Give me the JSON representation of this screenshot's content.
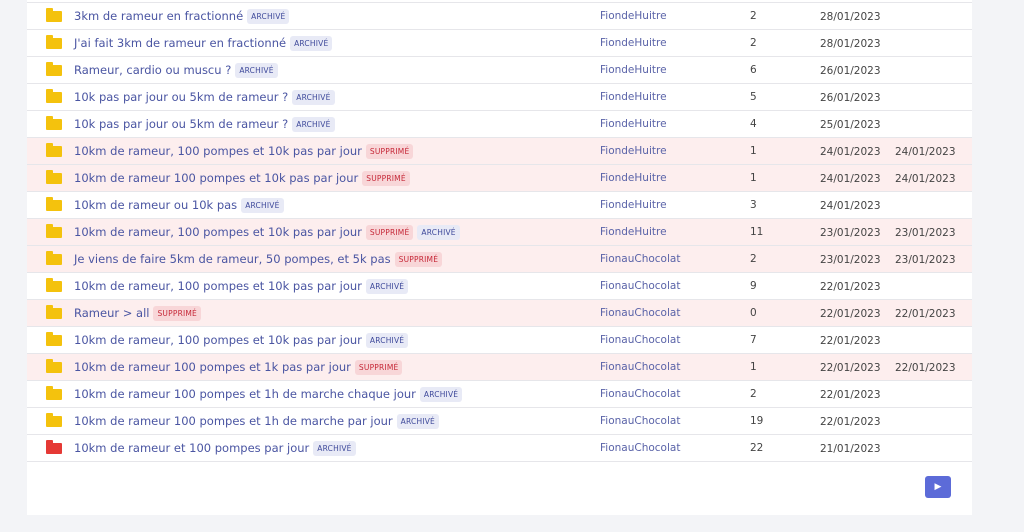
{
  "rows": [
    {
      "title": "3km de rameur en fractionné",
      "badges": [
        "ARCHIVÉ"
      ],
      "author": "FiondeHuitre",
      "count": "2",
      "date": "28/01/2023",
      "deleted_date": "",
      "state": "normal",
      "folder": "yellow"
    },
    {
      "title": "J'ai fait 3km de rameur en fractionné",
      "badges": [
        "ARCHIVÉ"
      ],
      "author": "FiondeHuitre",
      "count": "2",
      "date": "28/01/2023",
      "deleted_date": "",
      "state": "normal",
      "folder": "yellow"
    },
    {
      "title": "Rameur, cardio ou muscu ?",
      "badges": [
        "ARCHIVÉ"
      ],
      "author": "FiondeHuitre",
      "count": "6",
      "date": "26/01/2023",
      "deleted_date": "",
      "state": "normal",
      "folder": "yellow"
    },
    {
      "title": "10k pas par jour ou 5km de rameur ?",
      "badges": [
        "ARCHIVÉ"
      ],
      "author": "FiondeHuitre",
      "count": "5",
      "date": "26/01/2023",
      "deleted_date": "",
      "state": "normal",
      "folder": "yellow"
    },
    {
      "title": "10k pas par jour ou 5km de rameur ?",
      "badges": [
        "ARCHIVÉ"
      ],
      "author": "FiondeHuitre",
      "count": "4",
      "date": "25/01/2023",
      "deleted_date": "",
      "state": "normal",
      "folder": "yellow"
    },
    {
      "title": "10km de rameur, 100 pompes et 10k pas par jour",
      "badges": [
        "SUPPRIMÉ"
      ],
      "author": "FiondeHuitre",
      "count": "1",
      "date": "24/01/2023",
      "deleted_date": "24/01/2023",
      "state": "deleted",
      "folder": "yellow"
    },
    {
      "title": "10km de rameur 100 pompes et 10k pas par jour",
      "badges": [
        "SUPPRIMÉ"
      ],
      "author": "FiondeHuitre",
      "count": "1",
      "date": "24/01/2023",
      "deleted_date": "24/01/2023",
      "state": "deleted",
      "folder": "yellow"
    },
    {
      "title": "10km de rameur ou 10k pas",
      "badges": [
        "ARCHIVÉ"
      ],
      "author": "FiondeHuitre",
      "count": "3",
      "date": "24/01/2023",
      "deleted_date": "",
      "state": "normal",
      "folder": "yellow"
    },
    {
      "title": "10km de rameur, 100 pompes et 10k pas par jour",
      "badges": [
        "SUPPRIMÉ",
        "ARCHIVÉ"
      ],
      "author": "FiondeHuitre",
      "count": "11",
      "date": "23/01/2023",
      "deleted_date": "23/01/2023",
      "state": "deleted",
      "folder": "yellow"
    },
    {
      "title": "Je viens de faire 5km de rameur, 50 pompes, et 5k pas",
      "badges": [
        "SUPPRIMÉ"
      ],
      "author": "FionauChocolat",
      "count": "2",
      "date": "23/01/2023",
      "deleted_date": "23/01/2023",
      "state": "deleted",
      "folder": "yellow"
    },
    {
      "title": "10km de rameur, 100 pompes et 10k pas par jour",
      "badges": [
        "ARCHIVÉ"
      ],
      "author": "FionauChocolat",
      "count": "9",
      "date": "22/01/2023",
      "deleted_date": "",
      "state": "normal",
      "folder": "yellow"
    },
    {
      "title": "Rameur > all",
      "badges": [
        "SUPPRIMÉ"
      ],
      "author": "FionauChocolat",
      "count": "0",
      "date": "22/01/2023",
      "deleted_date": "22/01/2023",
      "state": "deleted",
      "folder": "yellow"
    },
    {
      "title": "10km de rameur, 100 pompes et 10k pas par jour",
      "badges": [
        "ARCHIVÉ"
      ],
      "author": "FionauChocolat",
      "count": "7",
      "date": "22/01/2023",
      "deleted_date": "",
      "state": "normal",
      "folder": "yellow"
    },
    {
      "title": "10km de rameur 100 pompes et 1k pas par jour",
      "badges": [
        "SUPPRIMÉ"
      ],
      "author": "FionauChocolat",
      "count": "1",
      "date": "22/01/2023",
      "deleted_date": "22/01/2023",
      "state": "deleted",
      "folder": "yellow"
    },
    {
      "title": "10km de rameur 100 pompes et 1h de marche chaque jour",
      "badges": [
        "ARCHIVÉ"
      ],
      "author": "FionauChocolat",
      "count": "2",
      "date": "22/01/2023",
      "deleted_date": "",
      "state": "normal",
      "folder": "yellow"
    },
    {
      "title": "10km de rameur 100 pompes et 1h de marche par jour",
      "badges": [
        "ARCHIVÉ"
      ],
      "author": "FionauChocolat",
      "count": "19",
      "date": "22/01/2023",
      "deleted_date": "",
      "state": "normal",
      "folder": "yellow"
    },
    {
      "title": "10km de rameur et 100 pompes par jour",
      "badges": [
        "ARCHIVÉ"
      ],
      "author": "FionauChocolat",
      "count": "22",
      "date": "21/01/2023",
      "deleted_date": "",
      "state": "normal",
      "folder": "red"
    }
  ],
  "pagination": {
    "next_icon": "play-arrow-icon",
    "next_glyph": "▶",
    "accent": "#5c6bd8"
  },
  "colors": {
    "deleted_row": "#fdeeee",
    "title": "#4a55a2",
    "archive_badge": "#e8eaf6",
    "deleted_badge": "#f8d6d8",
    "folder_yellow": "#f4c20d",
    "folder_red": "#e53935"
  }
}
